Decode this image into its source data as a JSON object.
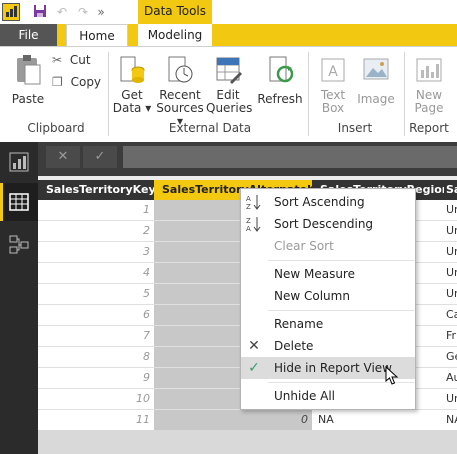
{
  "titlebar": {
    "context_tab": "Data Tools",
    "qa_more": "»"
  },
  "tabs": {
    "file": "File",
    "home": "Home",
    "modeling": "Modeling"
  },
  "ribbon": {
    "paste": "Paste",
    "cut": "Cut",
    "copy": "Copy",
    "get_data": [
      "Get",
      "Data ▾"
    ],
    "recent_sources": [
      "Recent",
      "Sources ▾"
    ],
    "edit_queries": [
      "Edit",
      "Queries"
    ],
    "refresh": "Refresh",
    "text_box": [
      "Text",
      "Box"
    ],
    "image": "Image",
    "new_page": [
      "New",
      "Page"
    ],
    "groups": {
      "clipboard": "Clipboard",
      "external_data": "External Data",
      "insert": "Insert",
      "report": "Report"
    }
  },
  "formula_bar": {
    "cancel": "✕",
    "commit": "✓"
  },
  "table": {
    "columns": [
      "SalesTerritoryKey",
      "SalesTerritoryAlternateKey",
      "SalesTerritoryRegion",
      "Sa"
    ],
    "rows": [
      {
        "key": "1",
        "alt": "",
        "region": "",
        "c4": "Un"
      },
      {
        "key": "2",
        "alt": "",
        "region": "",
        "c4": "Un"
      },
      {
        "key": "3",
        "alt": "",
        "region": "",
        "c4": "Un"
      },
      {
        "key": "4",
        "alt": "",
        "region": "",
        "c4": "Un"
      },
      {
        "key": "5",
        "alt": "",
        "region": "",
        "c4": "Un"
      },
      {
        "key": "6",
        "alt": "",
        "region": "",
        "c4": "Ca"
      },
      {
        "key": "7",
        "alt": "",
        "region": "",
        "c4": "Fr"
      },
      {
        "key": "8",
        "alt": "",
        "region": "",
        "c4": "Ge"
      },
      {
        "key": "9",
        "alt": "",
        "region": "",
        "c4": "Au"
      },
      {
        "key": "10",
        "alt": "",
        "region": "",
        "c4": "Un"
      },
      {
        "key": "11",
        "alt": "0",
        "region": "NA",
        "c4": "NA"
      }
    ]
  },
  "context_menu": {
    "sort_ascending": "Sort Ascending",
    "sort_descending": "Sort Descending",
    "clear_sort": "Clear Sort",
    "new_measure": "New Measure",
    "new_column": "New Column",
    "rename": "Rename",
    "delete": "Delete",
    "hide_in_report_view": "Hide in Report View",
    "unhide_all": "Unhide All"
  },
  "colors": {
    "accent": "#f2c811",
    "rail": "#2b2b2b",
    "header": "#333333",
    "selected_col": "#c8c8c8"
  }
}
